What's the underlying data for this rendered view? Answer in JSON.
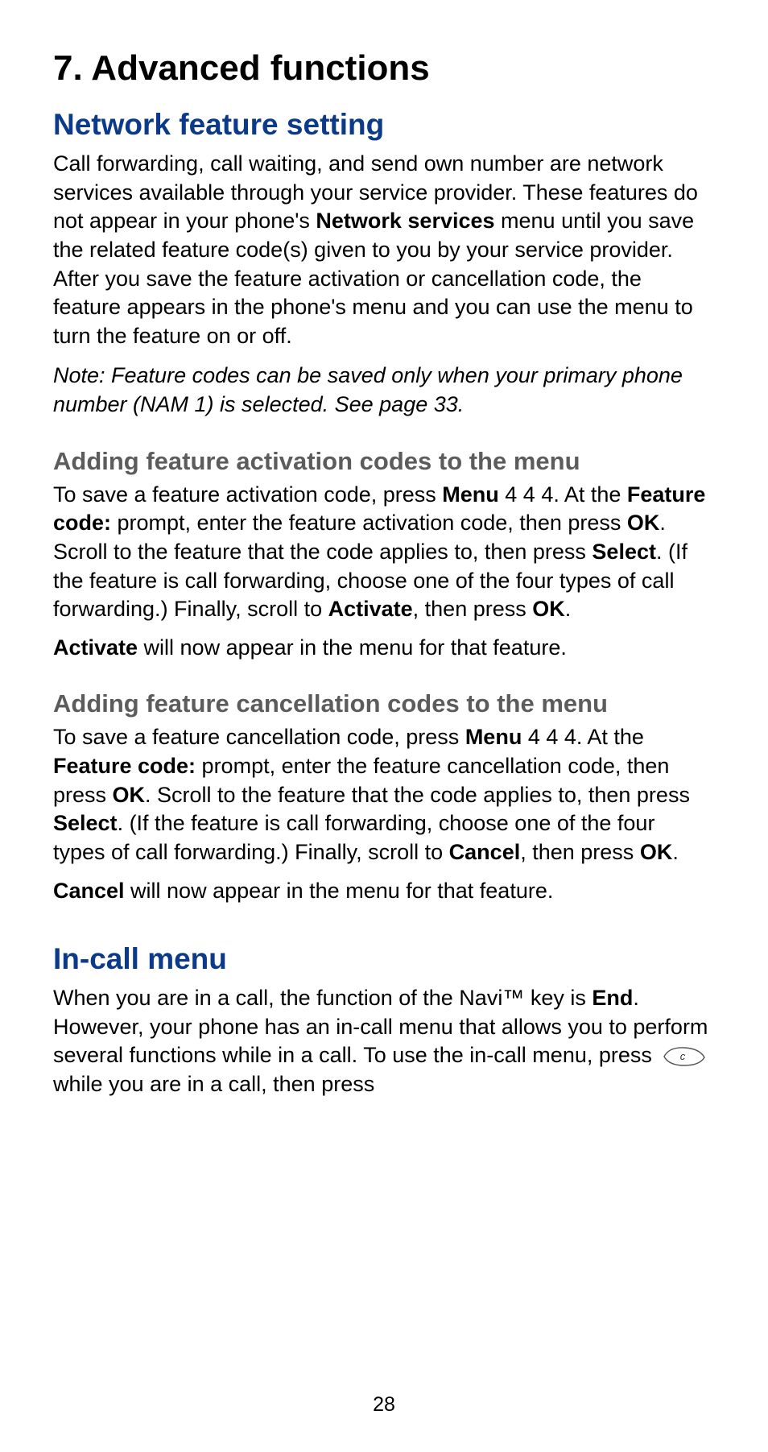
{
  "chapter_title": "7. Advanced functions",
  "section1": {
    "title": "Network feature setting",
    "intro_a": "Call forwarding, call waiting, and send own number are network services available through your service provider. These features do not appear in your phone's ",
    "intro_b_bold": "Network services",
    "intro_c": " menu until you save the related feature code(s) given to you by your service provider. After you save the feature activation or cancellation code, the feature appears in the phone's menu and you can use the menu to turn the feature on or off.",
    "note": "Note:  Feature codes can be saved only when your primary phone number (NAM 1) is selected. See page 33.",
    "sub1": {
      "title": "Adding feature activation codes to the menu",
      "p1_a": "To save a feature activation code, press ",
      "p1_menu": "Menu",
      "p1_b": " 4 4 4. At the ",
      "p1_featurecode": "Feature code:",
      "p1_c": " prompt, enter the feature activation code, then press ",
      "p1_ok1": "OK",
      "p1_d": ". Scroll to the feature that the code applies to, then press ",
      "p1_select": "Select",
      "p1_e": ". (If the feature is call forwarding, choose one of the four types of call forwarding.) Finally, scroll to ",
      "p1_activate": "Activate",
      "p1_f": ", then press ",
      "p1_ok2": "OK",
      "p1_g": ".",
      "p2_a_bold": "Activate",
      "p2_b": " will now appear in the menu for that feature."
    },
    "sub2": {
      "title": "Adding feature cancellation codes to the menu",
      "p1_a": "To save a feature cancellation code, press ",
      "p1_menu": "Menu",
      "p1_b": " 4 4 4. At the ",
      "p1_featurecode": "Feature code:",
      "p1_c": " prompt, enter the feature cancellation code, then press ",
      "p1_ok1": "OK",
      "p1_d": ". Scroll to the feature that the code applies to, then press ",
      "p1_select": "Select",
      "p1_e": ". (If the feature is call forwarding, choose one of the four types of call forwarding.) Finally, scroll to ",
      "p1_cancel": "Cancel",
      "p1_f": ", then press ",
      "p1_ok2": "OK",
      "p1_g": ".",
      "p2_a_bold": "Cancel",
      "p2_b": " will now appear in the menu for that feature."
    }
  },
  "section2": {
    "title": "In-call menu",
    "p1_a": "When you are in a call, the  function of the Navi™ key  is ",
    "p1_end": "End",
    "p1_b": ". However, your phone has an in-call menu that allows you to perform several functions while in a call. To use the in-call menu, press  ",
    "p1_c": "  while you are in a call, then press"
  },
  "page_number": "28"
}
